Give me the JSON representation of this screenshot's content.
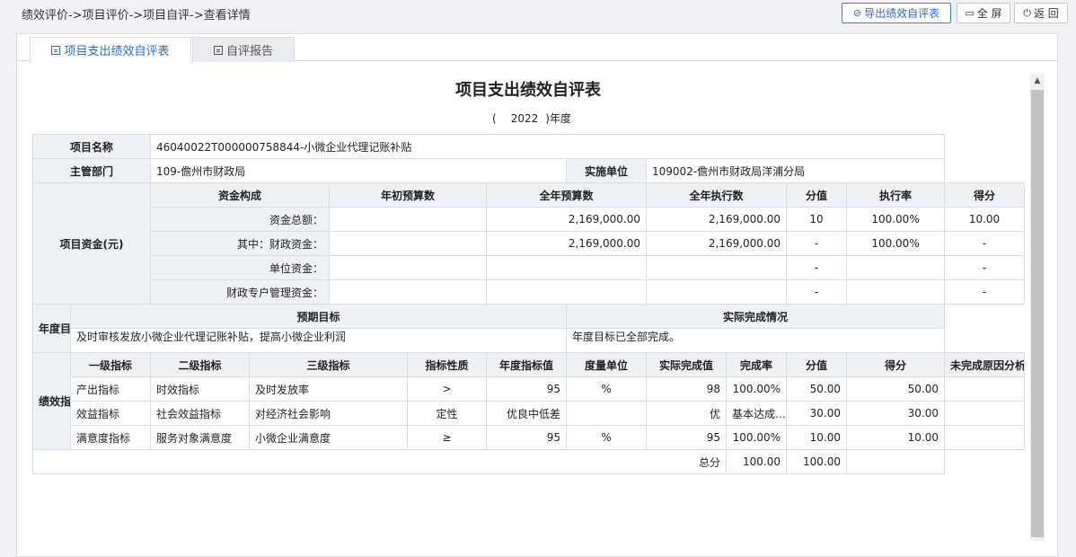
{
  "breadcrumb": "绩效评价->项目评价->项目自评->查看详情",
  "buttons": {
    "export": "导出绩效自评表",
    "fullscreen": "全 屏",
    "back": "返 回"
  },
  "tabs": [
    {
      "label": "项目支出绩效自评表"
    },
    {
      "label": "自评报告"
    }
  ],
  "doc": {
    "title": "项目支出绩效自评表",
    "year_open": "(",
    "year": "2022",
    "year_close": ")年度"
  },
  "info": {
    "project_name_label": "项目名称",
    "project_name": "46040022T000000758844-小微企业代理记账补贴",
    "dept_label": "主管部门",
    "dept": "109-儋州市财政局",
    "unit_label": "实施单位",
    "unit": "109002-儋州市财政局洋浦分局"
  },
  "funds": {
    "label": "项目资金(元)",
    "headers": [
      "资金构成",
      "年初预算数",
      "全年预算数",
      "全年执行数",
      "分值",
      "执行率",
      "得分"
    ],
    "rows": [
      {
        "name": "资金总额：",
        "initial": "",
        "budget": "2,169,000.00",
        "executed": "2,169,000.00",
        "score_value": "10",
        "rate": "100.00%",
        "score": "10.00"
      },
      {
        "name": "其中：财政资金：",
        "initial": "",
        "budget": "2,169,000.00",
        "executed": "2,169,000.00",
        "score_value": "-",
        "rate": "100.00%",
        "score": "-"
      },
      {
        "name": "单位资金：",
        "initial": "",
        "budget": "",
        "executed": "",
        "score_value": "-",
        "rate": "",
        "score": "-"
      },
      {
        "name": "财政专户管理资金：",
        "initial": "",
        "budget": "",
        "executed": "",
        "score_value": "-",
        "rate": "",
        "score": "-"
      }
    ]
  },
  "goals": {
    "label": "年度目标",
    "expected_header": "预期目标",
    "actual_header": "实际完成情况",
    "expected": "及时审核发放小微企业代理记账补贴，提高小微企业利润",
    "actual": "年度目标已全部完成。"
  },
  "indicators": {
    "label": "绩效指标",
    "headers": [
      "一级指标",
      "二级指标",
      "三级指标",
      "指标性质",
      "年度指标值",
      "度量单位",
      "实际完成值",
      "完成率",
      "分值",
      "得分",
      "未完成原因分析"
    ],
    "rows": [
      {
        "l1": "产出指标",
        "l2": "时效指标",
        "l3": "及时发放率",
        "nature": ">",
        "target": "95",
        "unit": "%",
        "actual": "98",
        "rate": "100.00%",
        "value": "50.00",
        "score": "50.00",
        "reason": ""
      },
      {
        "l1": "效益指标",
        "l2": "社会效益指标",
        "l3": "对经济社会影响",
        "nature": "定性",
        "target": "优良中低差",
        "unit": "",
        "actual": "优",
        "rate": "基本达成…",
        "value": "30.00",
        "score": "30.00",
        "reason": ""
      },
      {
        "l1": "满意度指标",
        "l2": "服务对象满意度",
        "l3": "小微企业满意度",
        "nature": "≥",
        "target": "95",
        "unit": "%",
        "actual": "95",
        "rate": "100.00%",
        "value": "10.00",
        "score": "10.00",
        "reason": ""
      }
    ],
    "total_label": "总分",
    "total_value": "100.00",
    "total_score": "100.00"
  }
}
